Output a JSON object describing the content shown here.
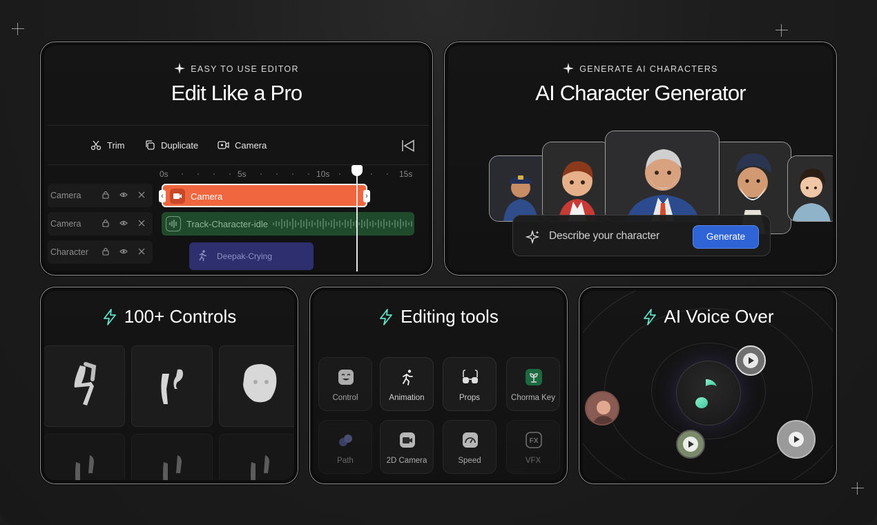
{
  "editor_card": {
    "kicker": "EASY TO USE EDITOR",
    "title": "Edit Like a Pro",
    "toolbar": {
      "trim": "Trim",
      "duplicate": "Duplicate",
      "camera": "Camera"
    },
    "ruler": [
      "0s",
      "5s",
      "10s",
      "15s"
    ],
    "tracks": [
      {
        "label": "Camera"
      },
      {
        "label": "Camera"
      },
      {
        "label": "Character"
      }
    ],
    "clips": {
      "camera": "Camera",
      "audio": "Track-Character-idle",
      "character": "Deepak-Crying"
    }
  },
  "character_card": {
    "kicker": "GENERATE AI CHARACTERS",
    "title": "AI Character Generator",
    "prompt_placeholder": "Describe your character",
    "generate_label": "Generate"
  },
  "controls_card": {
    "title": "100+ Controls"
  },
  "tools_card": {
    "title": "Editing tools",
    "tools": [
      "Control",
      "Animation",
      "Props",
      "Chorma Key",
      "Path",
      "2D Camera",
      "Speed",
      "VFX"
    ]
  },
  "voice_card": {
    "title": "AI Voice Over"
  },
  "colors": {
    "accent_teal": "#5fe0c7",
    "clip_orange": "#f0673f",
    "audio_green": "#1f4a2c",
    "generate_blue": "#2f64d6"
  }
}
